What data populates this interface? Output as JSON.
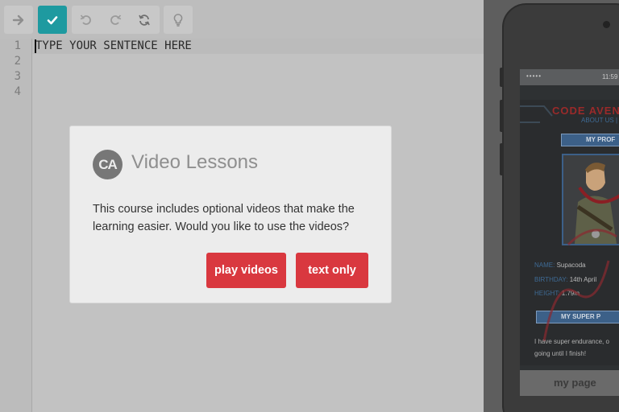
{
  "toolbar": {
    "icons": [
      "arrow-right-icon",
      "check-icon",
      "undo-icon",
      "redo-icon",
      "refresh-icon",
      "lightbulb-icon"
    ],
    "accent_color": "#1e9aa0"
  },
  "editor": {
    "line_numbers": [
      "1",
      "2",
      "3",
      "4"
    ],
    "code": "TYPE YOUR SENTENCE HERE"
  },
  "phone": {
    "status_dots": "•••••",
    "status_time": "11:59",
    "site_title": "CODE AVEN",
    "nav_text": "ABOUT US |",
    "profile_heading": "MY PROF",
    "name_label": "NAME:",
    "name_value": "Supacoda",
    "birthday_label": "BIRTHDAY:",
    "birthday_value": "14th April",
    "height_label": "HEIGHT:",
    "height_value": "1.79m",
    "powers_heading": "MY SUPER P",
    "bio": "I have super endurance, o going until I finish!",
    "tab_label": "my page"
  },
  "modal": {
    "logo": "CA",
    "title": "Video Lessons",
    "body": "This course includes optional videos that make the learning easier. Would you like to use the videos?",
    "play_label": "play videos",
    "text_label": "text only",
    "button_color": "#d9383f"
  }
}
